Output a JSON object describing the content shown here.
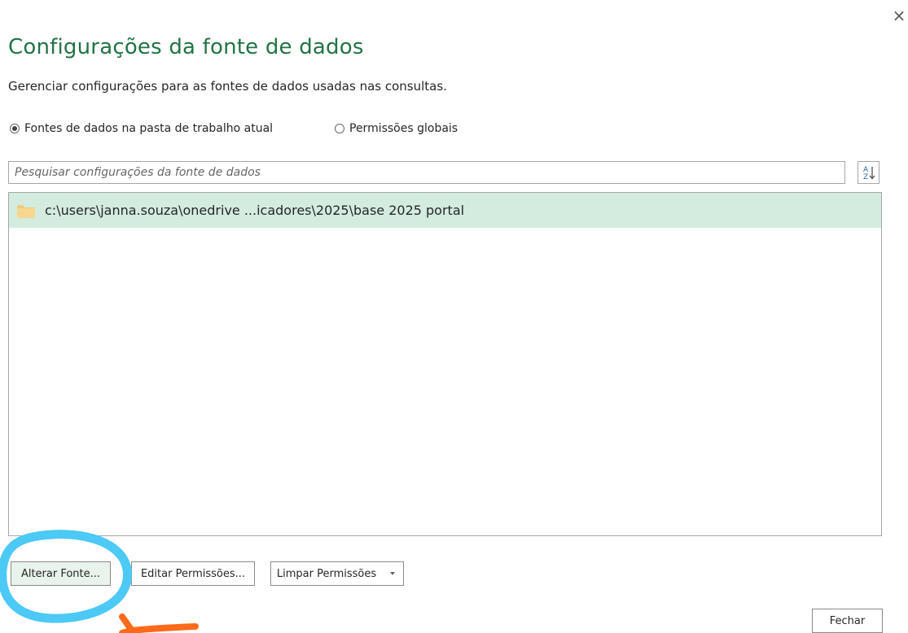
{
  "dialog": {
    "title": "Configurações da fonte de dados",
    "subtitle": "Gerenciar configurações para as fontes de dados usadas nas consultas.",
    "close_symbol": "×"
  },
  "scope": {
    "options": [
      {
        "label": "Fontes de dados na pasta de trabalho atual",
        "selected": true
      },
      {
        "label": "Permissões globais",
        "selected": false
      }
    ]
  },
  "search": {
    "placeholder": "Pesquisar configurações da fonte de dados",
    "value": ""
  },
  "sort": {
    "icon": "sort-az-icon",
    "label_top": "A",
    "label_bottom": "Z"
  },
  "sources": [
    {
      "label": "c:\\users\\janna.souza\\onedrive ...icadores\\2025\\base 2025 portal",
      "icon": "folder-icon",
      "selected": true
    }
  ],
  "buttons": {
    "change_source": "Alterar Fonte...",
    "edit_permissions": "Editar Permissões...",
    "clear_permissions": "Limpar Permissões",
    "close": "Fechar"
  },
  "colors": {
    "title_green": "#217346",
    "selected_row": "#d3ecdf",
    "annotation_circle": "#4cc9f5",
    "annotation_arrow": "#ff6a1a"
  }
}
